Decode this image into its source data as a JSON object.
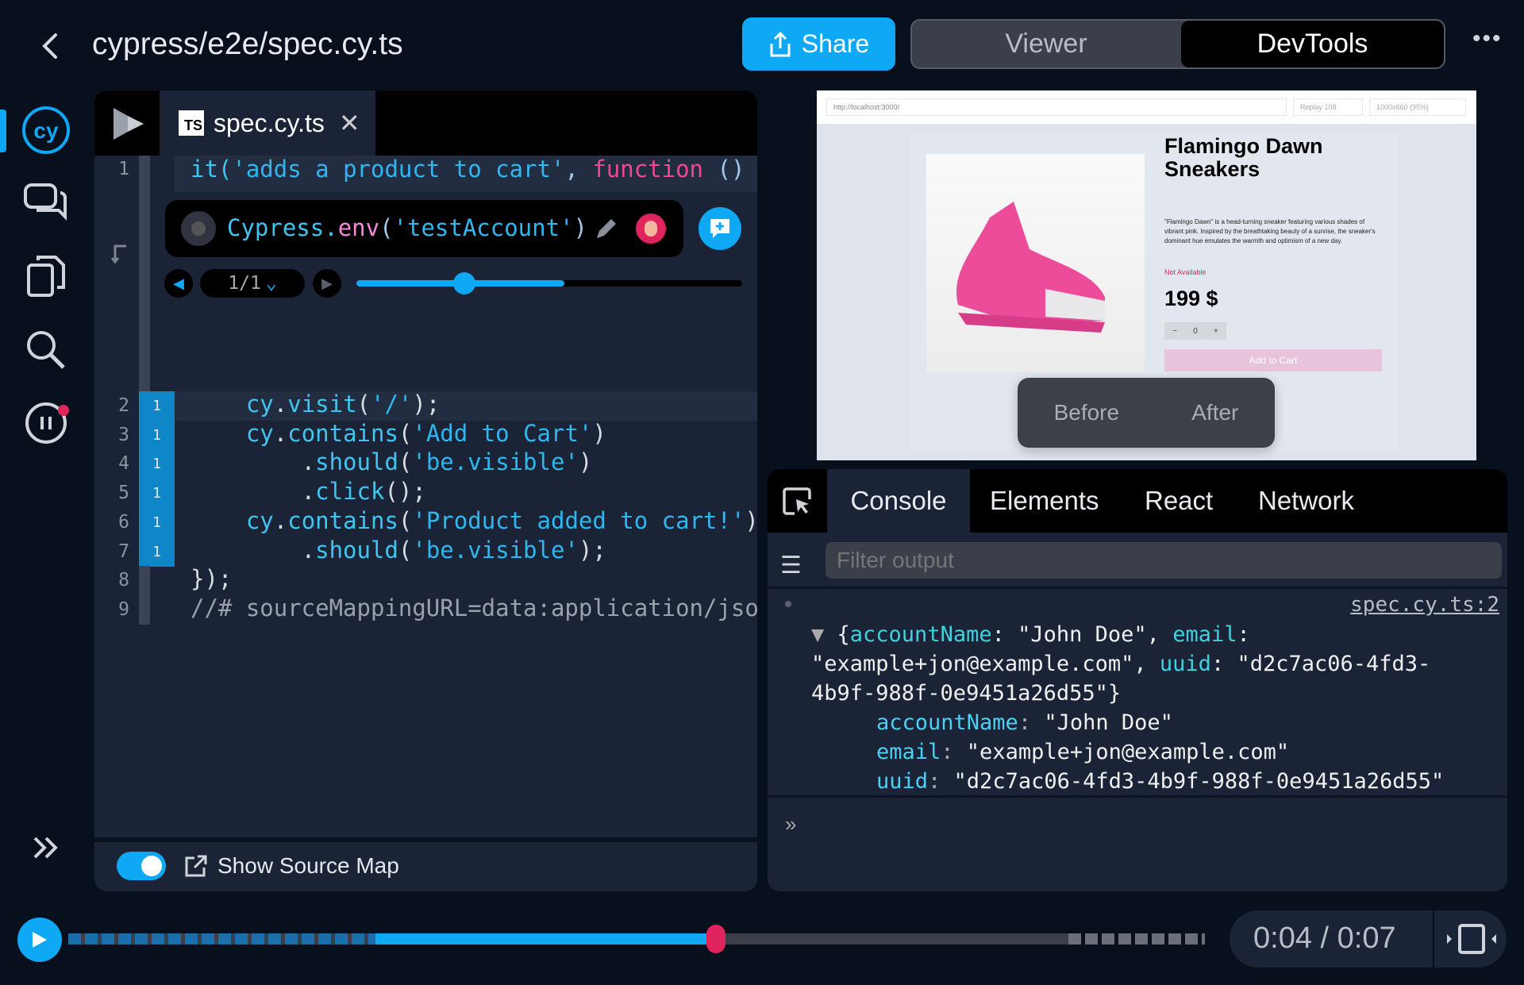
{
  "header": {
    "title": "cypress/e2e/spec.cy.ts",
    "share_label": "Share",
    "view_options": [
      "Viewer",
      "DevTools"
    ],
    "active_view": "DevTools",
    "more_icon": "more-horizontal-icon"
  },
  "sidebar": {
    "items": [
      {
        "icon": "cypress-logo-icon",
        "active": true
      },
      {
        "icon": "comments-icon"
      },
      {
        "icon": "files-icon"
      },
      {
        "icon": "search-icon"
      },
      {
        "icon": "pause-replay-icon"
      }
    ],
    "expand_icon": "chevrons-right-icon"
  },
  "editor": {
    "tab": {
      "badge": "TS",
      "label": "spec.cy.ts"
    },
    "line1": {
      "num": "1",
      "parts": [
        "it(",
        "'adds a product to cart'",
        ", ",
        "function",
        " () {"
      ]
    },
    "popup": {
      "parts": [
        "Cypress.",
        "env",
        "(",
        "'testAccount'",
        ")"
      ],
      "counter": "1/1",
      "slider_percent": 50
    },
    "lines": [
      {
        "num": "2",
        "hits": "1",
        "code": "    cy.visit('/');"
      },
      {
        "num": "3",
        "hits": "1",
        "code": "    cy.contains('Add to Cart')"
      },
      {
        "num": "4",
        "hits": "1",
        "code": "        .should('be.visible')"
      },
      {
        "num": "5",
        "hits": "1",
        "code": "        .click();"
      },
      {
        "num": "6",
        "hits": "1",
        "code": "    cy.contains('Product added to cart!')"
      },
      {
        "num": "7",
        "hits": "1",
        "code": "        .should('be.visible');"
      },
      {
        "num": "8",
        "hits": "",
        "code": "});"
      },
      {
        "num": "9",
        "hits": "",
        "code": "//# sourceMappingURL=data:application/json;"
      }
    ],
    "footer": {
      "toggle_on": true,
      "label": "Show Source Map"
    }
  },
  "preview": {
    "url": "http://localhost:3000/",
    "replay": "Replay 108",
    "viewport": "1000x660 (95%)",
    "product": {
      "title": "Flamingo Dawn Sneakers",
      "description": "\"Flamingo Dawn\" is a head-turning sneaker featuring various shades of vibrant pink. Inspired by the breathtaking beauty of a sunrise, the sneaker's dominant hue emulates the warmth and optimism of a new day.",
      "availability": "Not Available",
      "price": "199 $",
      "quantity": "0",
      "add_to_cart": "Add to Cart"
    },
    "before_label": "Before",
    "after_label": "After"
  },
  "devtools": {
    "tabs": [
      "Console",
      "Elements",
      "React",
      "Network"
    ],
    "active_tab": "Console",
    "filter_placeholder": "Filter output",
    "source_link": "spec.cy.ts:2",
    "summary": {
      "k1": "accountName",
      "v1": "\"John Doe\"",
      "k2": "email",
      "v2": "\"example+jon@example.com\"",
      "k3": "uuid",
      "v3a": "\"d2c7ac06-4fd3-",
      "v3b": "4b9f-988f-0e9451a26d55\"}"
    },
    "props": [
      {
        "key": "accountName",
        "value": "\"John Doe\""
      },
      {
        "key": "email",
        "value": "\"example+jon@example.com\""
      },
      {
        "key": "uuid",
        "value": "\"d2c7ac06-4fd3-4b9f-988f-0e9451a26d55\""
      }
    ],
    "prompt": "»"
  },
  "player": {
    "current": "0:04",
    "total": "0:07",
    "time_text": "0:04 / 0:07",
    "progress_percent": 57
  },
  "colors": {
    "accent": "#0fa8f5",
    "scrubber": "#e0245e",
    "keyword": "#f0479a",
    "bg": "#080f1d",
    "panel": "#1b2436"
  }
}
